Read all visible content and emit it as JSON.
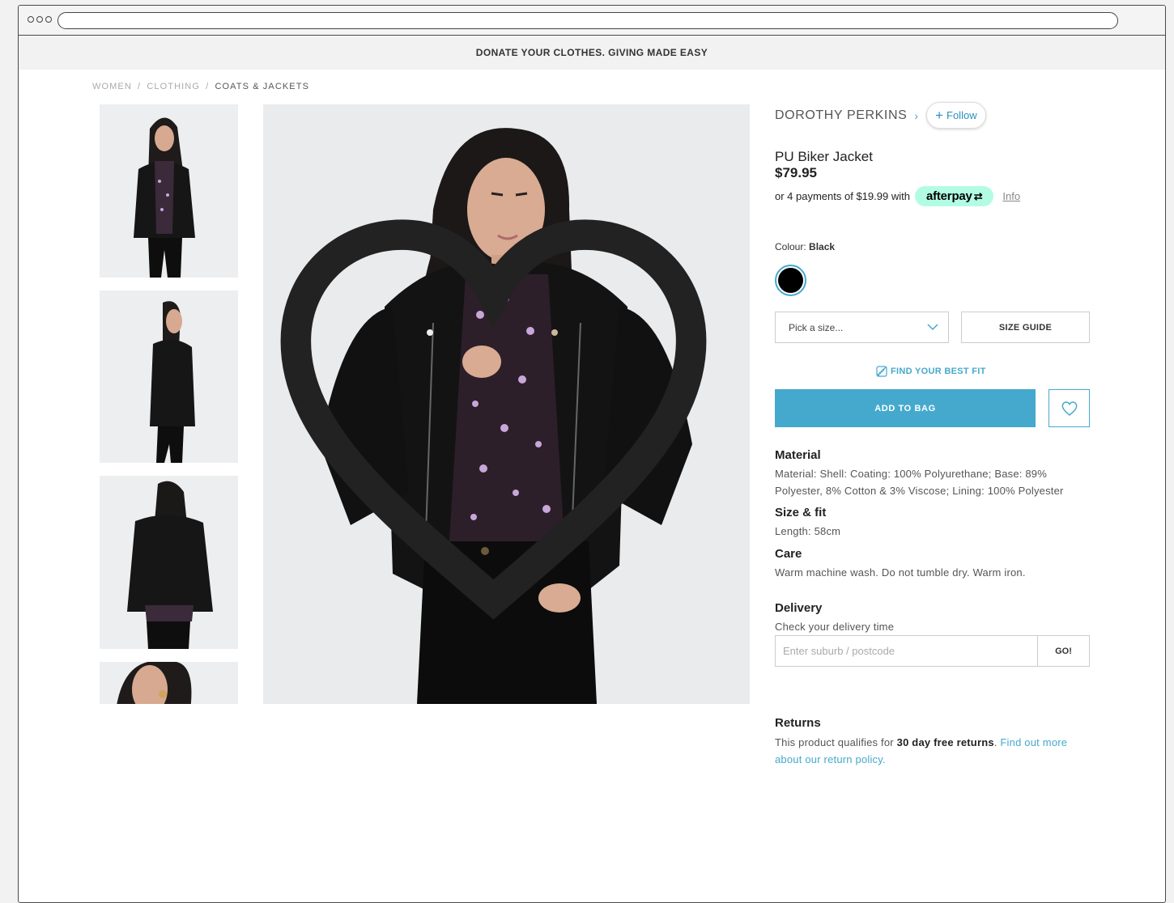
{
  "promo": {
    "text": "DONATE YOUR CLOTHES. GIVING MADE EASY"
  },
  "breadcrumb": {
    "items": [
      "WOMEN",
      "CLOTHING",
      "COATS & JACKETS"
    ],
    "sep": "/"
  },
  "product": {
    "brand": "DOROTHY PERKINS",
    "follow_label": "Follow",
    "name": "PU Biker Jacket",
    "price": "$79.95",
    "afterpay_text": "or 4 payments of $19.99 with",
    "afterpay_logo": "afterpay",
    "info_label": "Info",
    "colour_label": "Colour:",
    "colour_value": "Black",
    "size_placeholder": "Pick a size...",
    "size_guide_label": "SIZE GUIDE",
    "best_fit_label": "FIND YOUR BEST FIT",
    "add_to_bag_label": "ADD TO BAG"
  },
  "details": {
    "material_h": "Material",
    "material_t": "Material: Shell: Coating: 100% Polyurethane; Base: 89% Polyester, 8% Cotton & 3% Viscose; Lining: 100% Polyester",
    "fit_h": "Size & fit",
    "fit_t": "Length: 58cm",
    "care_h": "Care",
    "care_t": "Warm machine wash. Do not tumble dry. Warm iron.",
    "delivery_h": "Delivery",
    "delivery_t": "Check your delivery time",
    "postcode_placeholder": "Enter suburb / postcode",
    "go_label": "GO!",
    "returns_h": "Returns",
    "returns_pre": "This product qualifies for",
    "returns_bold": "30 day free returns",
    "returns_post": ".",
    "returns_link": "Find out more about our return policy."
  },
  "colors": {
    "accent": "#45a9cd",
    "afterpay": "#b2fce4",
    "swatch": "#000000"
  },
  "icons": {
    "favourite": "heart-icon",
    "brand_arrow": "chevron-right-icon",
    "follow": "plus-icon",
    "size_dropdown": "chevron-down-icon",
    "best_fit": "measuring-tape-icon",
    "wishlist": "heart-icon"
  }
}
